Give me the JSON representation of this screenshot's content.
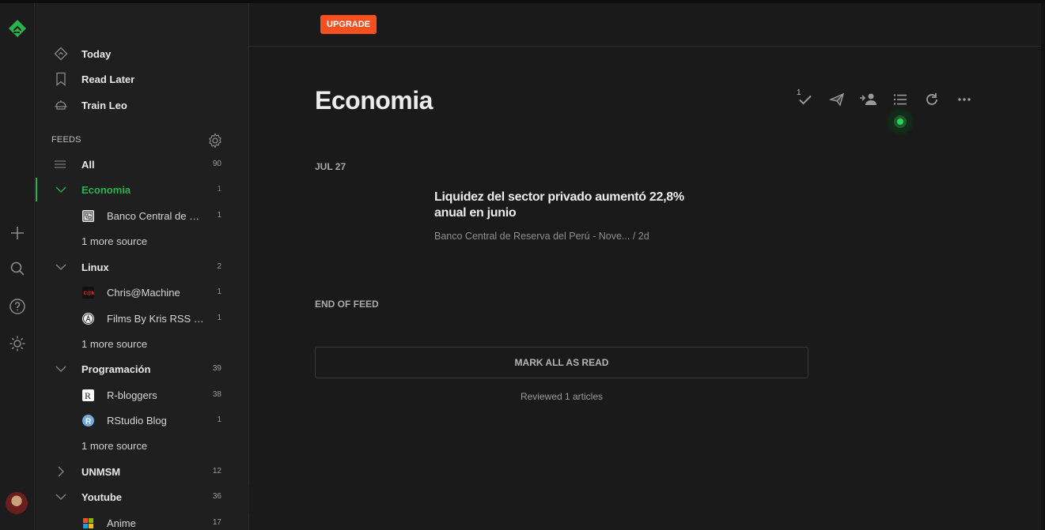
{
  "sidebar": {
    "nav": [
      {
        "label": "Today",
        "icon": "today-icon"
      },
      {
        "label": "Read Later",
        "icon": "bookmark-icon"
      },
      {
        "label": "Train Leo",
        "icon": "leo-icon"
      }
    ],
    "feeds_title": "FEEDS",
    "rows": {
      "all": {
        "label": "All",
        "count": "90"
      },
      "economia": {
        "label": "Economia",
        "count": "1"
      },
      "banco": {
        "label": "Banco Central de Reserva del Perú - Novedades",
        "count": "1"
      },
      "economia_more": {
        "label": "1 more source"
      },
      "linux": {
        "label": "Linux",
        "count": "2"
      },
      "chris": {
        "label": "Chris@Machine",
        "count": "1"
      },
      "films": {
        "label": "Films By Kris RSS Feed",
        "count": "1"
      },
      "linux_more": {
        "label": "1 more source"
      },
      "programacion": {
        "label": "Programación",
        "count": "39"
      },
      "rbloggers": {
        "label": "R-bloggers",
        "count": "38"
      },
      "rstudio": {
        "label": "RStudio Blog",
        "count": "1"
      },
      "prog_more": {
        "label": "1 more source"
      },
      "unmsm": {
        "label": "UNMSM",
        "count": "12"
      },
      "youtube": {
        "label": "Youtube",
        "count": "36"
      },
      "anime": {
        "label": "Anime",
        "count": "17"
      }
    }
  },
  "header": {
    "upgrade_label": "UPGRADE"
  },
  "main": {
    "title": "Economia",
    "toolbar_badge": "1",
    "date_heading": "JUL 27",
    "entry": {
      "title": "Liquidez del sector privado aumentó 22,8% anual en junio",
      "meta": "Banco Central de Reserva del Perú - Nove... / 2d"
    },
    "end_label": "END OF FEED",
    "mark_all_label": "MARK ALL AS READ",
    "reviewed": "Reviewed 1 articles"
  },
  "colors": {
    "accent": "#2bb24c",
    "upgrade": "#f5501f",
    "background": "#1a1a1a"
  }
}
